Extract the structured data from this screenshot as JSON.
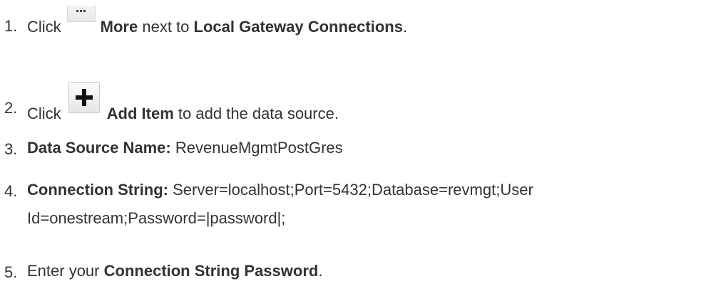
{
  "steps": [
    {
      "number": "1.",
      "pre": "Click",
      "icon": "more-icon",
      "bold": "More",
      "mid": "next to",
      "bold2": "Local Gateway Connections",
      "post": "."
    },
    {
      "number": "2.",
      "pre": "Click",
      "icon": "plus-icon",
      "bold": "Add Item",
      "post": "to add the data source."
    },
    {
      "number": "3.",
      "bold": "Data Source Name:",
      "post": "RevenueMgmtPostGres"
    },
    {
      "number": "4.",
      "bold": "Connection String:",
      "line1": "Server=localhost;Port=5432;Database=revmgt;User",
      "line2": "Id=onestream;Password=|password|;"
    },
    {
      "number": "5.",
      "pre": "Enter your",
      "bold": "Connection String Password",
      "post": "."
    }
  ]
}
